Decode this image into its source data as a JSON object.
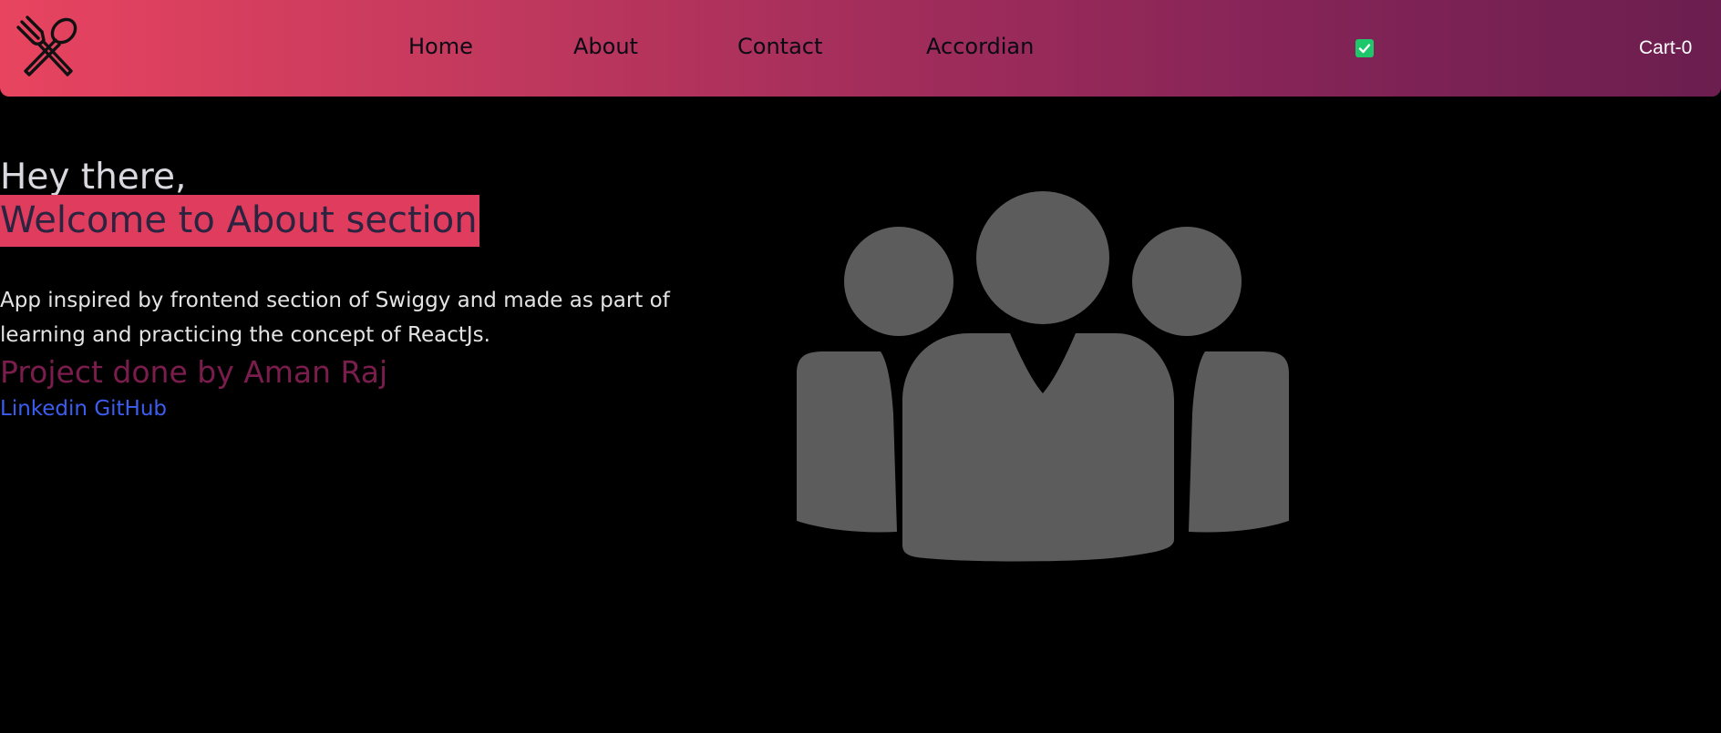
{
  "header": {
    "logo_icon": "fork-spoon-icon",
    "nav": {
      "home": "Home",
      "about": "About",
      "contact": "Contact",
      "accordian": "Accordian"
    },
    "toggle_icon": "checkbox-checked-icon",
    "cart_label": "Cart-0"
  },
  "about": {
    "greeting": "Hey there,",
    "welcome": "Welcome to About section",
    "description": "App inspired by frontend section of Swiggy and made as part of learning and practicing the concept of ReactJs.",
    "credit": "Project done by Aman Raj",
    "links": {
      "linkedin": "Linkedin",
      "github": "GitHub"
    },
    "illustration_icon": "team-people-icon"
  },
  "colors": {
    "header_start": "#e8445f",
    "header_end": "#6b1e4f",
    "welcome_highlight": "#e03c5e",
    "credit_text": "#7a1d4d",
    "link": "#3b5df0",
    "toggle": "#1ec76a",
    "illustration": "#5c5c5c"
  }
}
